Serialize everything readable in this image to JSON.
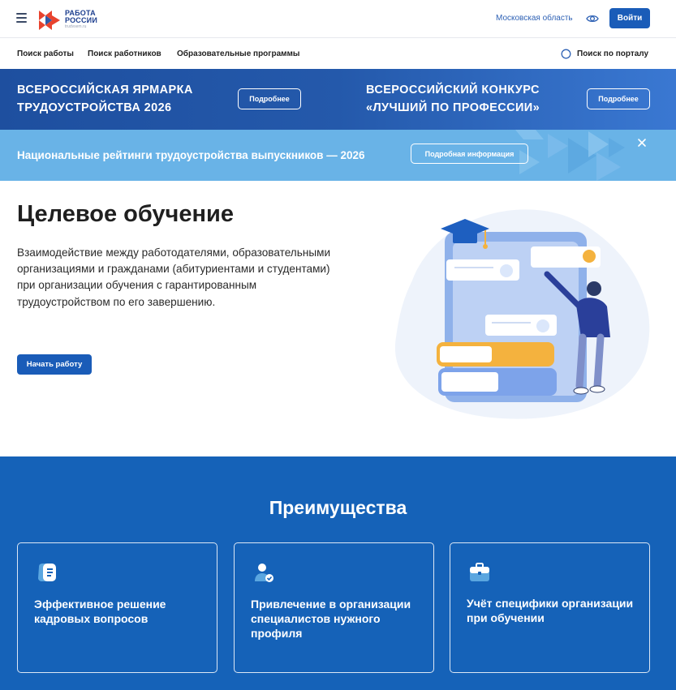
{
  "header": {
    "logo_line1": "РАБОТА",
    "logo_line2": "РОССИИ",
    "logo_line3": "trudvsem.ru",
    "region": "Московская область",
    "login_label": "Войти"
  },
  "nav": {
    "items": [
      {
        "label": "Поиск работы"
      },
      {
        "label": "Поиск работников"
      },
      {
        "label": "Образовательные программы"
      }
    ],
    "search_label": "Поиск по порталу"
  },
  "banner_fair": {
    "title_line1": "ВСЕРОССИЙСКАЯ ЯРМАРКА",
    "title_line2": "ТРУДОУСТРОЙСТВА 2026",
    "button": "Подробнее"
  },
  "banner_contest": {
    "title_line1": "ВСЕРОССИЙСКИЙ КОНКУРС",
    "title_line2": "«ЛУЧШИЙ ПО ПРОФЕССИИ»",
    "button": "Подробнее"
  },
  "banner_ratings": {
    "title": "Национальные рейтинги трудоустройства выпускников — 2026",
    "button": "Подробная информация"
  },
  "hero": {
    "title": "Целевое обучение",
    "text": "Взаимодействие между работодателями, образовательными организациями и гражданами (абитуриентами и студентами) при организации обучения с гарантированным трудоустройством по его завершению.",
    "button": "Начать работу"
  },
  "advantages": {
    "title": "Преимущества",
    "cards": [
      {
        "icon": "chat-document-icon",
        "text": "Эффективное решение кадровых вопросов"
      },
      {
        "icon": "user-check-icon",
        "text": "Привлечение в организации специалистов нужного профиля"
      },
      {
        "icon": "briefcase-icon",
        "text": "Учёт специфики организации при обучении"
      }
    ]
  },
  "colors": {
    "primary": "#1a5cb8",
    "advantages_bg": "#1562b8",
    "banner_dark": "#2459ab",
    "banner_light": "#69b3e7",
    "logo_red": "#e8432e"
  }
}
